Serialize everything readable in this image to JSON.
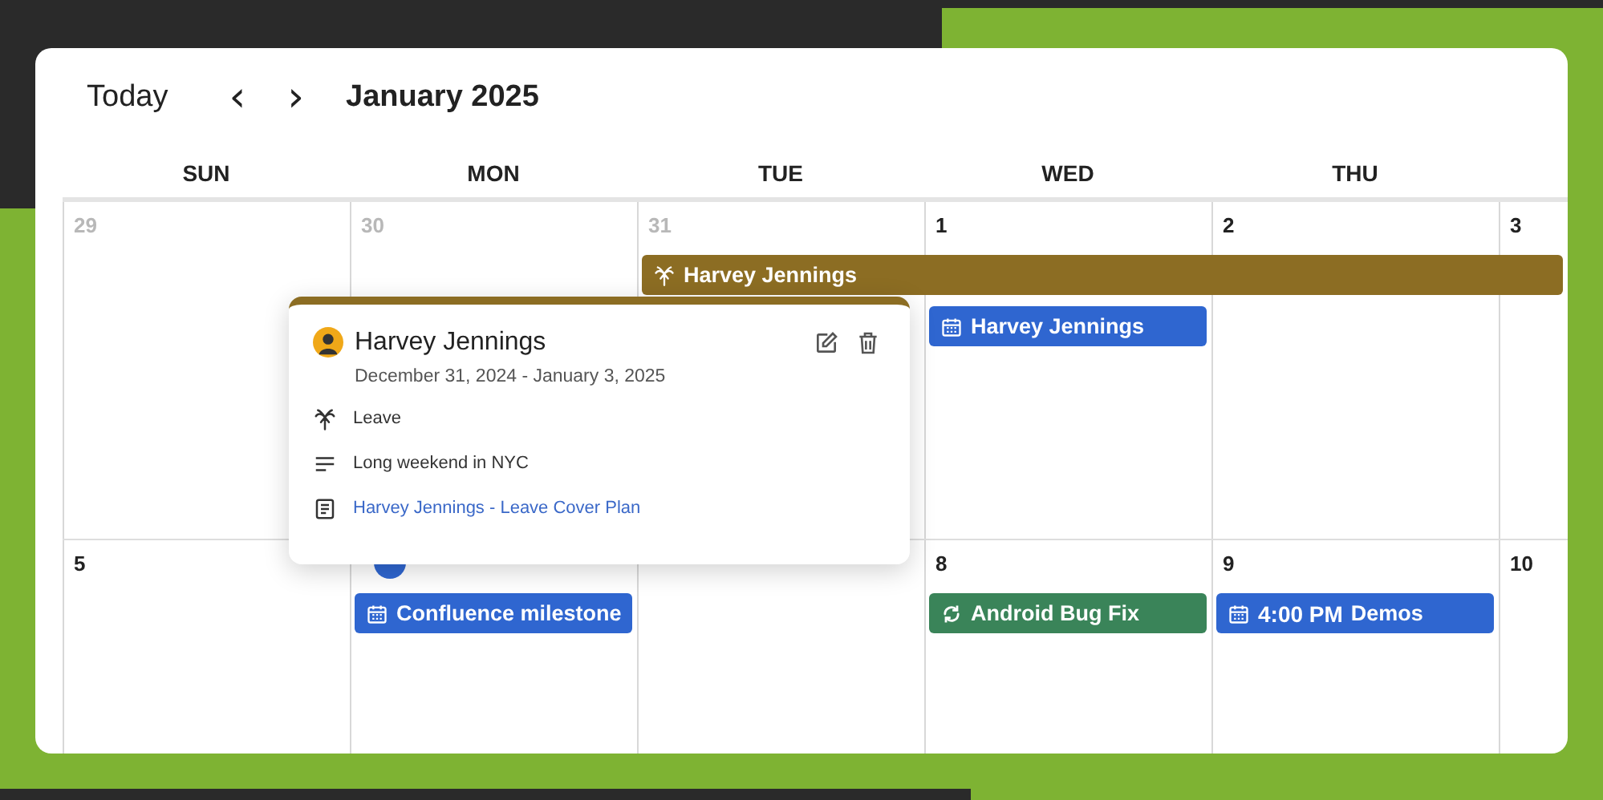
{
  "toolbar": {
    "today": "Today",
    "prev": "‹",
    "next": "›",
    "title": "January 2025"
  },
  "weekdays": [
    "SUN",
    "MON",
    "TUE",
    "WED",
    "THU"
  ],
  "weeks": [
    {
      "days": [
        {
          "kind": "dated",
          "label": "29",
          "muted": true
        },
        {
          "kind": "dated",
          "label": "30",
          "muted": true
        },
        {
          "kind": "dated",
          "label": "31",
          "muted": true,
          "events": [
            {
              "title": "Harvey Jennings",
              "kind": "leave",
              "color": "#8c6d23",
              "multi_day": true
            }
          ]
        },
        {
          "kind": "dated",
          "label": "1",
          "muted": false,
          "events": [
            {
              "title": "Harvey Jennings",
              "kind": "meeting",
              "color": "#2f66d0",
              "multi_day": false
            }
          ]
        },
        {
          "kind": "dated",
          "label": "2",
          "muted": false
        },
        {
          "kind": "dated",
          "label": "3",
          "muted": false
        }
      ]
    },
    {
      "days": [
        {
          "kind": "dated",
          "label": "5",
          "muted": false
        },
        {
          "kind": "covered",
          "events": [
            {
              "title": "Confluence milestone",
              "kind": "meeting",
              "color": "#2f66d0",
              "multi_day": false
            }
          ]
        },
        {
          "kind": "covered"
        },
        {
          "kind": "dated",
          "label": "8",
          "muted": false,
          "events": [
            {
              "title": "Android Bug Fix",
              "kind": "task",
              "color": "#3a8459",
              "multi_day": false
            }
          ]
        },
        {
          "kind": "dated",
          "label": "9",
          "muted": false,
          "events": [
            {
              "title": "Demos",
              "time": "4:00 PM",
              "kind": "meeting",
              "color": "#2f66d0",
              "multi_day": false
            }
          ]
        },
        {
          "kind": "dated",
          "label": "10",
          "muted": false
        }
      ]
    }
  ],
  "popup": {
    "color": "#8c6d23",
    "title": "Harvey Jennings",
    "dates": "December 31, 2024 - January 3, 2025",
    "type": "Leave",
    "description": "Long weekend in NYC",
    "link": "Harvey Jennings - Leave Cover Plan"
  }
}
